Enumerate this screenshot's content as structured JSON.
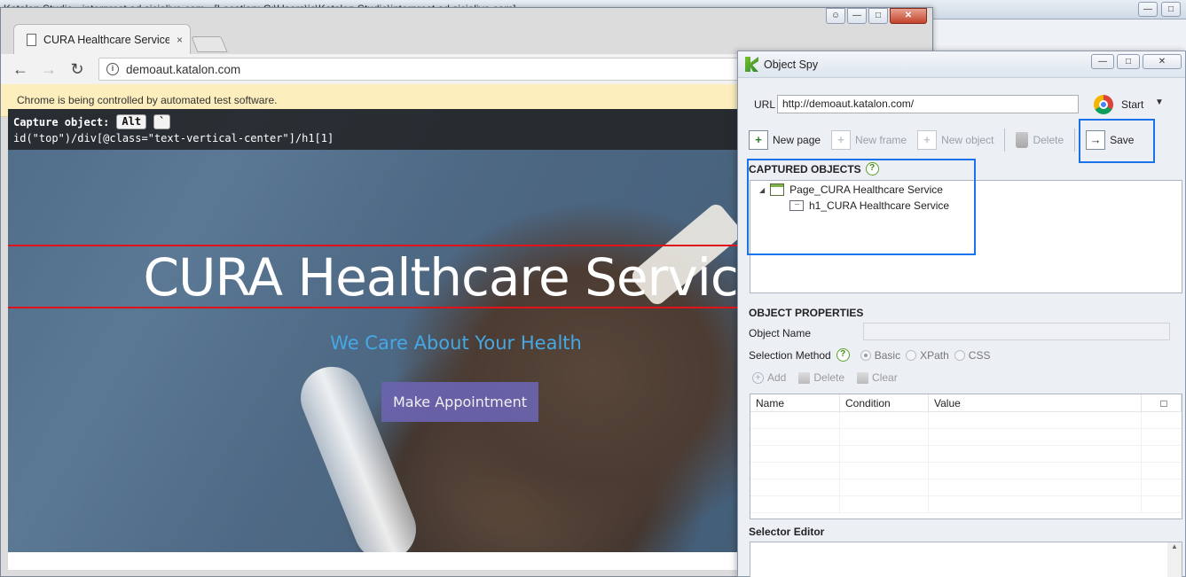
{
  "studio": {
    "title": "Katalon Studio - interprest ad sicialive.com - [Location: C:\\Users\\ic\\Katalon Studio\\interprest ad sicialive.com]",
    "min": "—",
    "max": "□",
    "close": "✕"
  },
  "chrome": {
    "tab_title": "CURA Healthcare Service",
    "tab_close": "×",
    "url": "demoaut.katalon.com",
    "infobar": "Chrome is being controlled by automated test software.",
    "back": "←",
    "forward": "→",
    "reload": "↻",
    "info_icon": "i",
    "user": "☺",
    "min": "—",
    "max": "□",
    "close": "✕"
  },
  "capture": {
    "label": "Capture object:",
    "key1": "Alt",
    "key2": "`",
    "xpath": "id(\"top\")/div[@class=\"text-vertical-center\"]/h1[1]"
  },
  "hero": {
    "title": "CURA Healthcare Service",
    "subtitle": "We Care About Your Health",
    "button": "Make Appointment"
  },
  "spy": {
    "title": "Object Spy",
    "min": "—",
    "max": "□",
    "close": "✕",
    "url_label": "URL",
    "url_value": "http://demoaut.katalon.com/",
    "start_label": "Start",
    "caret": "▼",
    "toolbar": {
      "new_page": "New page",
      "new_frame": "New frame",
      "new_object": "New object",
      "delete": "Delete",
      "save": "Save"
    },
    "captured_label": "CAPTURED OBJECTS",
    "help": "?",
    "tree": {
      "twist": "◢",
      "page": "Page_CURA Healthcare Service",
      "element": "h1_CURA Healthcare Service",
      "element_glyph": "···"
    },
    "properties_label": "OBJECT PROPERTIES",
    "object_name_label": "Object Name",
    "selection_method_label": "Selection Method",
    "methods": [
      "Basic",
      "XPath",
      "CSS"
    ],
    "actions": {
      "add": "Add",
      "delete": "Delete",
      "clear": "Clear"
    },
    "plus": "+",
    "columns": {
      "name": "Name",
      "condition": "Condition",
      "value": "Value",
      "check": "□"
    },
    "selector_editor_label": "Selector Editor",
    "scroll_up": "▲"
  }
}
